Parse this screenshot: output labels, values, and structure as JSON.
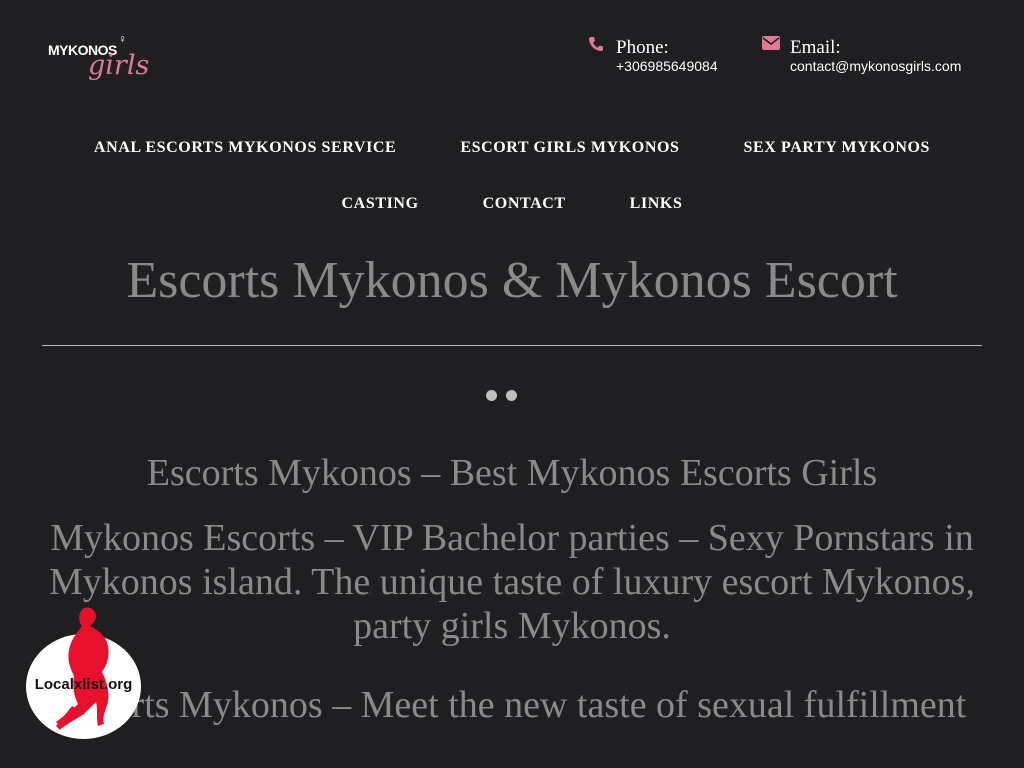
{
  "header": {
    "logo": {
      "main": "MYKONOS",
      "script": "girls"
    },
    "phone": {
      "label": "Phone:",
      "value": "+306985649084",
      "icon": "phone-icon"
    },
    "email": {
      "label": "Email:",
      "value": "contact@mykonosgirls.com",
      "icon": "envelope-icon"
    }
  },
  "nav": {
    "row1": [
      "ANAL ESCORTS MYKONOS SERVICE",
      "ESCORT GIRLS MYKONOS",
      "SEX PARTY MYKONOS"
    ],
    "row2": [
      "CASTING",
      "CONTACT",
      "LINKS"
    ]
  },
  "page": {
    "title": "Escorts Mykonos & Mykonos Escort",
    "headings": [
      "Escorts Mykonos – Best Mykonos Escorts Girls",
      "Mykonos Escorts – VIP Bachelor parties – Sexy Pornstars in Mykonos island. The unique taste of luxury escort Mykonos, party girls Mykonos.",
      "Escorts Mykonos – Meet the new taste of sexual fulfillment"
    ]
  },
  "slider": {
    "dots": 2
  },
  "badge": {
    "text": "Localxlist.org",
    "icon": "silhouette-icon"
  },
  "colors": {
    "accent": "#e27a95",
    "background": "#1f1e20",
    "muted_text": "#8a8a8a"
  }
}
